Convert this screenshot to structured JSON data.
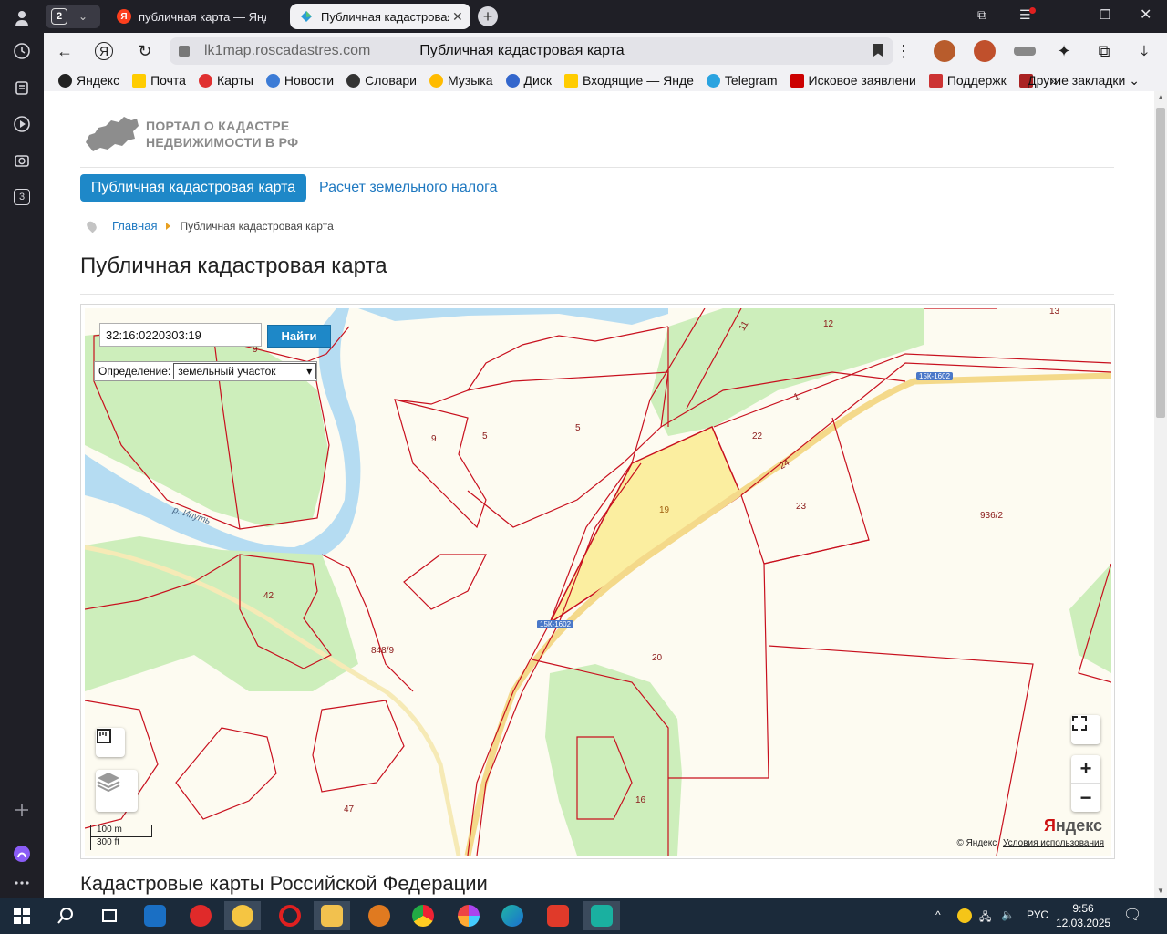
{
  "browser": {
    "tab_count": "2",
    "tabs": [
      {
        "title": "публичная карта — Яндекс",
        "favicon_letter": "Я",
        "favicon_color": "#fc3f1d"
      },
      {
        "title": "Публичная кадастровая",
        "favicon_color": "#2a9bd6"
      }
    ],
    "sidebar_badge": "3",
    "url_host": "lk1map.roscadastres.com",
    "page_title": "Публичная кадастровая карта",
    "bookmarks": [
      {
        "label": "Яндекс",
        "color": "#222222"
      },
      {
        "label": "Почта",
        "color": "#ffcc00"
      },
      {
        "label": "Карты",
        "color": "#e03030"
      },
      {
        "label": "Новости",
        "color": "#3c7bd6"
      },
      {
        "label": "Словари",
        "color": "#333333"
      },
      {
        "label": "Музыка",
        "color": "#ffbb00"
      },
      {
        "label": "Диск",
        "color": "#3366cc"
      },
      {
        "label": "Входящие — Янде",
        "color": "#ffcc00"
      },
      {
        "label": "Telegram",
        "color": "#2aa3e0"
      },
      {
        "label": "Исковое заявлени",
        "color": "#cc0000"
      },
      {
        "label": "Поддержк",
        "color": "#cc3333"
      }
    ],
    "more_bookmarks": "»",
    "other_bookmarks": "Другие закладки"
  },
  "site": {
    "logo_line1": "ПОРТАЛ О КАДАСТРЕ",
    "logo_line2": "НЕДВИЖИМОСТИ В РФ",
    "nav": {
      "active": "Публичная кадастровая карта",
      "link": "Расчет земельного налога"
    },
    "breadcrumb": {
      "home": "Главная",
      "current": "Публичная кадастровая карта"
    },
    "heading": "Публичная кадастровая карта",
    "subheading": "Кадастровые карты Российской Федерации"
  },
  "map": {
    "search_value": "32:16:0220303:19",
    "search_button": "Найти",
    "definition_label": "Определение:",
    "definition_value": "земельный участок",
    "parcel_labels": [
      "13",
      "12",
      "11",
      "9",
      "5",
      "5",
      "22",
      "1",
      "24",
      "19",
      "23",
      "936/2",
      "42",
      "848/9",
      "20",
      "16",
      "47",
      "/5"
    ],
    "road_labels": [
      "15К-1602",
      "15К-1602"
    ],
    "river_label": "р. Ипуть",
    "scale_m": "100 m",
    "scale_ft": "300 ft",
    "copyright": "© Яндекс",
    "terms_link": "Условия использования",
    "brand_first": "Я",
    "brand_rest": "ндекс",
    "zoom_in": "+",
    "zoom_out": "−",
    "colors": {
      "parcel_border": "#c8101e",
      "selected_fill": "#fbeea0",
      "forest": "#cdeebb",
      "water": "#b5dcf2",
      "road": "#f4d98a"
    }
  },
  "taskbar": {
    "language": "РУС",
    "time": "9:56",
    "date": "12.03.2025"
  }
}
